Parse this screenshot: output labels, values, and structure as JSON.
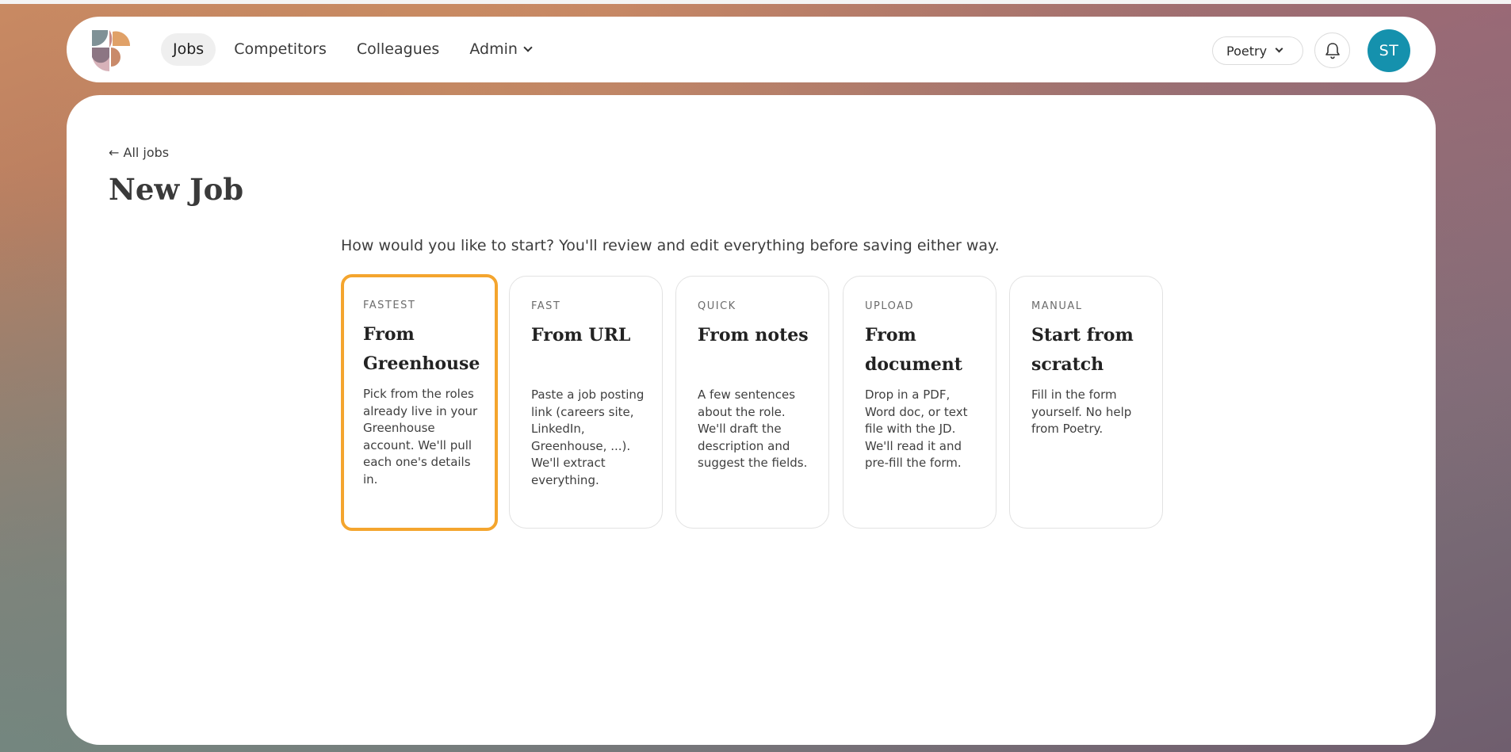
{
  "colors": {
    "accent_selected": "#f4a52e",
    "avatar_bg": "#1591ad",
    "nav_active_bg": "#efefef"
  },
  "header": {
    "logo_icon": "poetry-logo-icon",
    "nav": [
      {
        "label": "Jobs",
        "active": true
      },
      {
        "label": "Competitors",
        "active": false
      },
      {
        "label": "Colleagues",
        "active": false
      },
      {
        "label": "Admin",
        "active": false,
        "has_dropdown": true
      }
    ],
    "workspace_label": "Poetry",
    "notifications_icon": "bell-icon",
    "avatar_initials": "ST"
  },
  "main": {
    "back_link": "← All jobs",
    "title": "New Job",
    "prompt": "How would you like to start? You'll review and edit everything before saving either way.",
    "options": [
      {
        "kicker": "FASTEST",
        "title": "From Greenhouse",
        "description": "Pick from the roles already live in your Greenhouse account. We'll pull each one's details in.",
        "selected": true
      },
      {
        "kicker": "FAST",
        "title": "From URL",
        "description": "Paste a job posting link (careers site, LinkedIn, Greenhouse, ...). We'll extract everything.",
        "selected": false
      },
      {
        "kicker": "QUICK",
        "title": "From notes",
        "description": "A few sentences about the role. We'll draft the description and suggest the fields.",
        "selected": false
      },
      {
        "kicker": "UPLOAD",
        "title": "From document",
        "description": "Drop in a PDF, Word doc, or text file with the JD. We'll read it and pre-fill the form.",
        "selected": false
      },
      {
        "kicker": "MANUAL",
        "title": "Start from scratch",
        "description": "Fill in the form yourself. No help from Poetry.",
        "selected": false
      }
    ]
  }
}
